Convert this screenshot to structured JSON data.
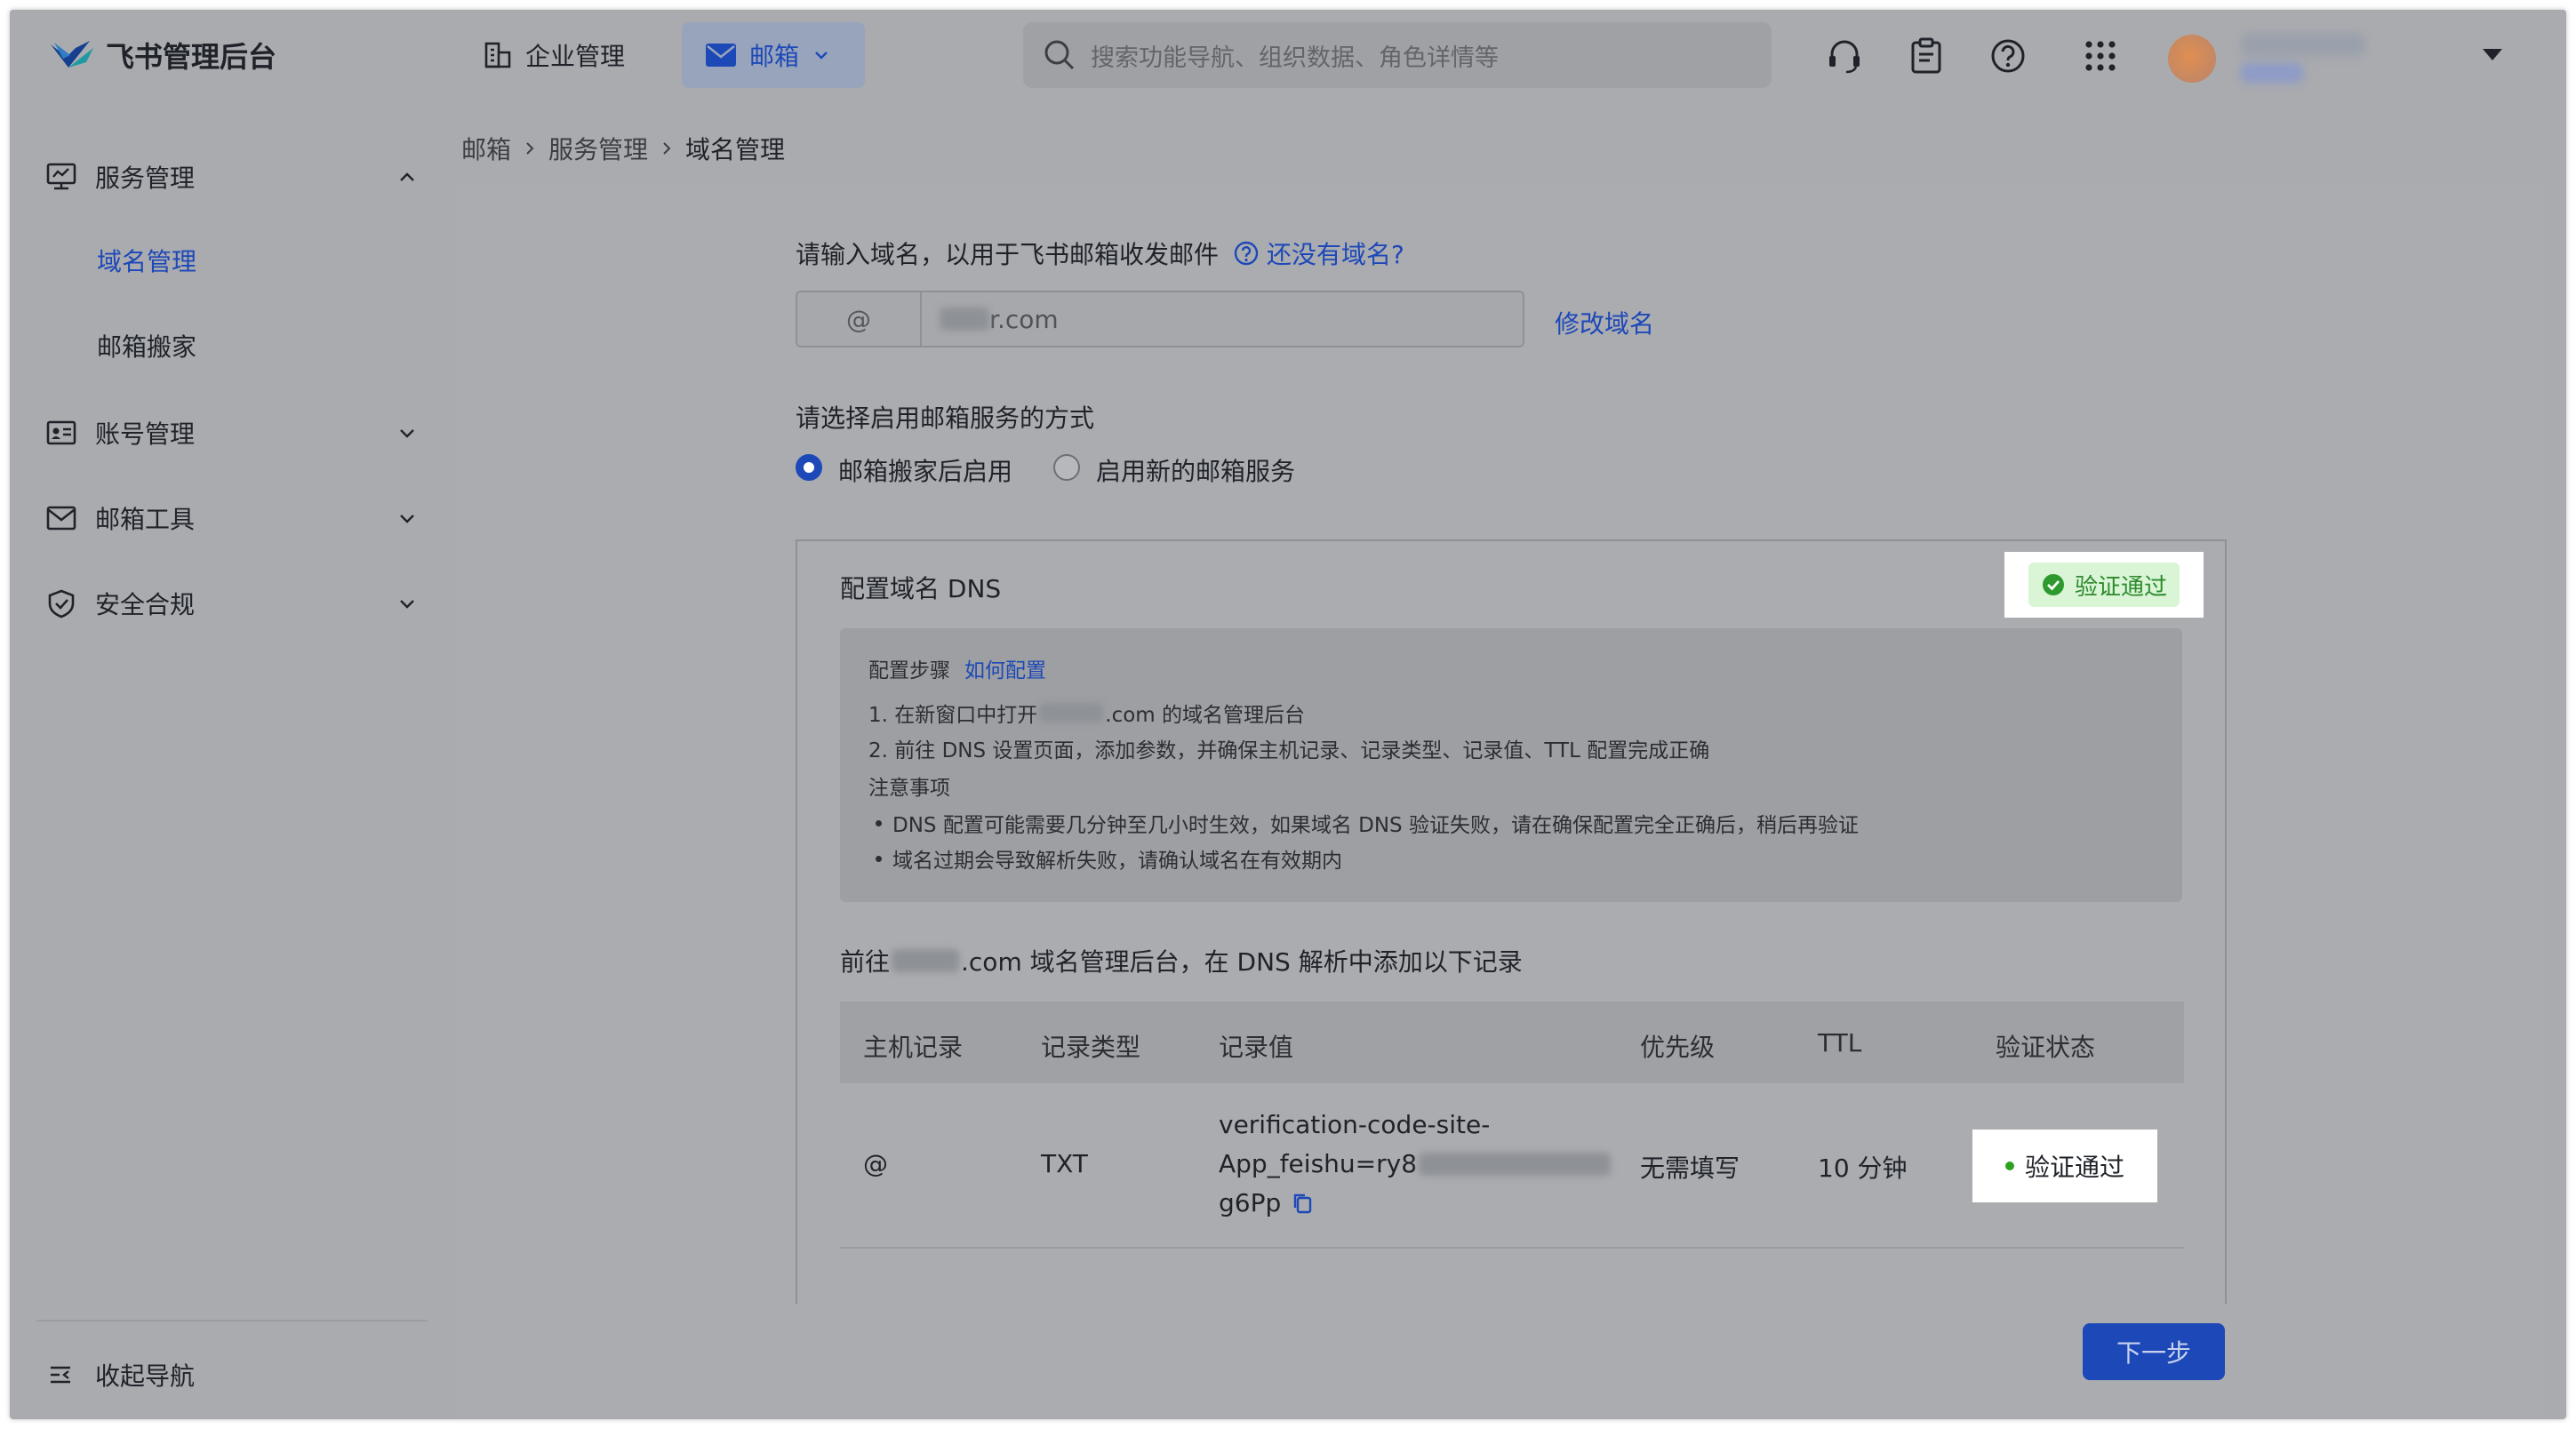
{
  "app": {
    "title": "飞书管理后台"
  },
  "topnav": {
    "enterprise": "企业管理",
    "mail": "邮箱"
  },
  "search": {
    "placeholder": "搜索功能导航、组织数据、角色详情等"
  },
  "topicons": [
    "headset-icon",
    "clipboard-icon",
    "help-icon",
    "apps-grid-icon"
  ],
  "sidebar": {
    "items": [
      {
        "label": "服务管理",
        "icon": "monitor-icon",
        "expanded": true
      },
      {
        "label": "账号管理",
        "icon": "id-card-icon",
        "expanded": false
      },
      {
        "label": "邮箱工具",
        "icon": "mail-icon",
        "expanded": false
      },
      {
        "label": "安全合规",
        "icon": "shield-icon",
        "expanded": false
      }
    ],
    "subitems": [
      {
        "label": "域名管理",
        "active": true
      },
      {
        "label": "邮箱搬家",
        "active": false
      }
    ],
    "collapse": "收起导航"
  },
  "breadcrumb": [
    "邮箱",
    "服务管理",
    "域名管理"
  ],
  "domain": {
    "prompt": "请输入域名，以用于飞书邮箱收发邮件",
    "help_link": "还没有域名?",
    "prefix": "@",
    "value_suffix": "r.com",
    "edit_link": "修改域名"
  },
  "service": {
    "prompt": "请选择启用邮箱服务的方式",
    "options": [
      {
        "label": "邮箱搬家后启用",
        "selected": true
      },
      {
        "label": "启用新的邮箱服务",
        "selected": false
      }
    ]
  },
  "dns": {
    "title": "配置域名 DNS",
    "status": "验证通过",
    "steps_title": "配置步骤",
    "how_link": "如何配置",
    "step1_pre": "1. 在新窗口中打开",
    "step1_post": ".com 的域名管理后台",
    "step2": "2. 前往 DNS 设置页面，添加参数，并确保主机记录、记录类型、记录值、TTL 配置完成正确",
    "notes_title": "注意事项",
    "note1": "DNS 配置可能需要几分钟至几小时生效，如果域名 DNS 验证失败，请在确保配置完全正确后，稍后再验证",
    "note2": "域名过期会导致解析失败，请确认域名在有效期内",
    "instr_pre": "前往",
    "instr_post": ".com 域名管理后台，在 DNS 解析中添加以下记录",
    "table": {
      "headers": [
        "主机记录",
        "记录类型",
        "记录值",
        "优先级",
        "TTL",
        "验证状态"
      ],
      "row": {
        "host": "@",
        "type": "TXT",
        "value_l1": "verification-code-site-",
        "value_l2": "App_feishu=ry8",
        "value_l3": "g6Pp",
        "priority": "无需填写",
        "ttl": "10 分钟",
        "status": "验证通过"
      }
    }
  },
  "next_button": "下一步",
  "colors": {
    "accent": "#1d48b8",
    "success": "#2ea121"
  }
}
